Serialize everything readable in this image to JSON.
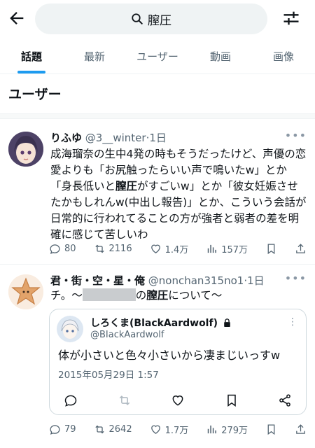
{
  "search": {
    "query": "膣圧"
  },
  "tabs": [
    {
      "label": "話題"
    },
    {
      "label": "最新"
    },
    {
      "label": "ユーザー"
    },
    {
      "label": "動画"
    },
    {
      "label": "画像"
    }
  ],
  "section": {
    "title": "ユーザー"
  },
  "tweets": [
    {
      "name": "りふゆ",
      "handle": "@3__winter",
      "time": "1日",
      "text_parts": [
        "成海瑠奈の生中4発の時もそうだったけど、声優の恋愛よりも「お尻触ったらいい声で鳴いたw」とか「身長低いと",
        "膣圧",
        "がすごいw」とか「彼女妊娠させたかもしれんw(中出し報告)」とか、こういう会話が日常的に行われてることの方が強者と弱者の差を明確に感じて苦しいわ"
      ],
      "stats": {
        "replies": "80",
        "retweets": "2116",
        "likes": "1.4万",
        "views": "157万"
      }
    },
    {
      "name": "君・街・空・星・俺",
      "handle": "@nonchan315no1",
      "time": "1日",
      "text_parts": [
        "チ。〜",
        "の",
        "膣圧",
        "について〜"
      ],
      "quote": {
        "name": "しろくま(BlackAardwolf)",
        "handle": "@BIackAardwolf",
        "text": "体が小さいと色々小さいから凄まじいっすw",
        "date": "2015年05月29日 1:57"
      },
      "stats": {
        "replies": "79",
        "retweets": "2642",
        "likes": "1.7万",
        "views": "279万"
      }
    }
  ],
  "colors": {
    "accent": "#1d9bf0",
    "muted": "#536471",
    "text": "#0f1419"
  },
  "icons": [
    "back-arrow-icon",
    "search-icon",
    "filter-icon",
    "more-icon",
    "reply-icon",
    "retweet-icon",
    "like-icon",
    "views-icon",
    "bookmark-icon",
    "share-icon",
    "lock-icon"
  ]
}
